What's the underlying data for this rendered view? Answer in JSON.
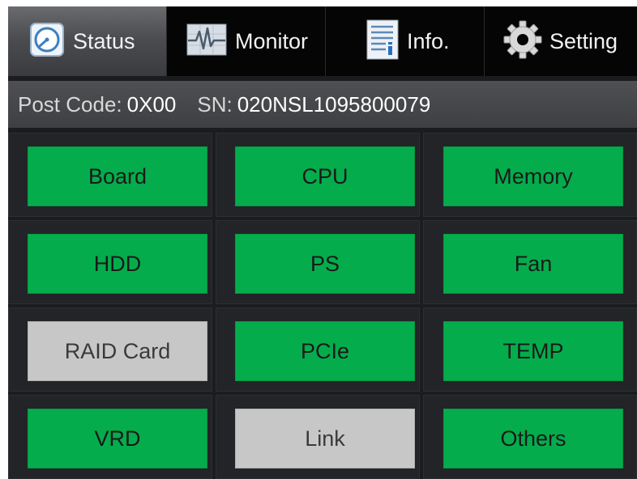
{
  "tabs": [
    {
      "label": "Status",
      "icon": "gauge-icon",
      "active": true
    },
    {
      "label": "Monitor",
      "icon": "waveform-icon",
      "active": false
    },
    {
      "label": "Info.",
      "icon": "document-info-icon",
      "active": false
    },
    {
      "label": "Setting",
      "icon": "gear-icon",
      "active": false
    }
  ],
  "info": {
    "post_code_label": "Post Code:",
    "post_code_value": "0X00",
    "sn_label": "SN:",
    "sn_value": "020NSL1095800079"
  },
  "components": [
    {
      "label": "Board",
      "state": "ok"
    },
    {
      "label": "CPU",
      "state": "ok"
    },
    {
      "label": "Memory",
      "state": "ok"
    },
    {
      "label": "HDD",
      "state": "ok"
    },
    {
      "label": "PS",
      "state": "ok"
    },
    {
      "label": "Fan",
      "state": "ok"
    },
    {
      "label": "RAID Card",
      "state": "not-present"
    },
    {
      "label": "PCIe",
      "state": "ok"
    },
    {
      "label": "TEMP",
      "state": "ok"
    },
    {
      "label": "VRD",
      "state": "ok"
    },
    {
      "label": "Link",
      "state": "not-present"
    },
    {
      "label": "Others",
      "state": "ok"
    }
  ],
  "colors": {
    "ok": "#05ac4c",
    "not_present": "#c7c7c7",
    "background": "#1b1c1f"
  }
}
